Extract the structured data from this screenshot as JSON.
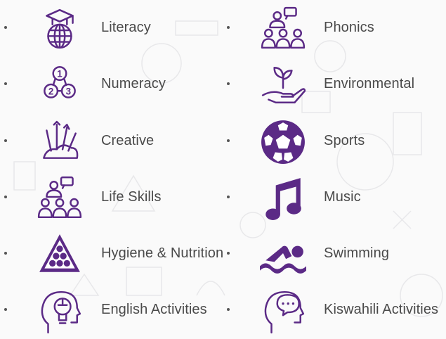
{
  "colors": {
    "accent": "#5b2a86",
    "text": "#4a4a4a"
  },
  "activities_left": [
    {
      "label": "Literacy",
      "icon": "graduation-globe-icon"
    },
    {
      "label": "Numeracy",
      "icon": "numbers-123-icon"
    },
    {
      "label": "Creative",
      "icon": "art-supplies-icon"
    },
    {
      "label": "Life Skills",
      "icon": "group-speaker-icon"
    },
    {
      "label": "Hygiene & Nutrition",
      "icon": "triangle-balls-icon"
    },
    {
      "label": "English Activities",
      "icon": "head-lightbulb-icon"
    }
  ],
  "activities_right": [
    {
      "label": "Phonics",
      "icon": "group-speaker-icon"
    },
    {
      "label": "Environmental",
      "icon": "plant-hand-icon"
    },
    {
      "label": "Sports",
      "icon": "soccer-ball-icon"
    },
    {
      "label": "Music",
      "icon": "music-note-icon"
    },
    {
      "label": "Swimming",
      "icon": "swimmer-icon"
    },
    {
      "label": "Kiswahili Activities",
      "icon": "head-speech-icon"
    }
  ]
}
